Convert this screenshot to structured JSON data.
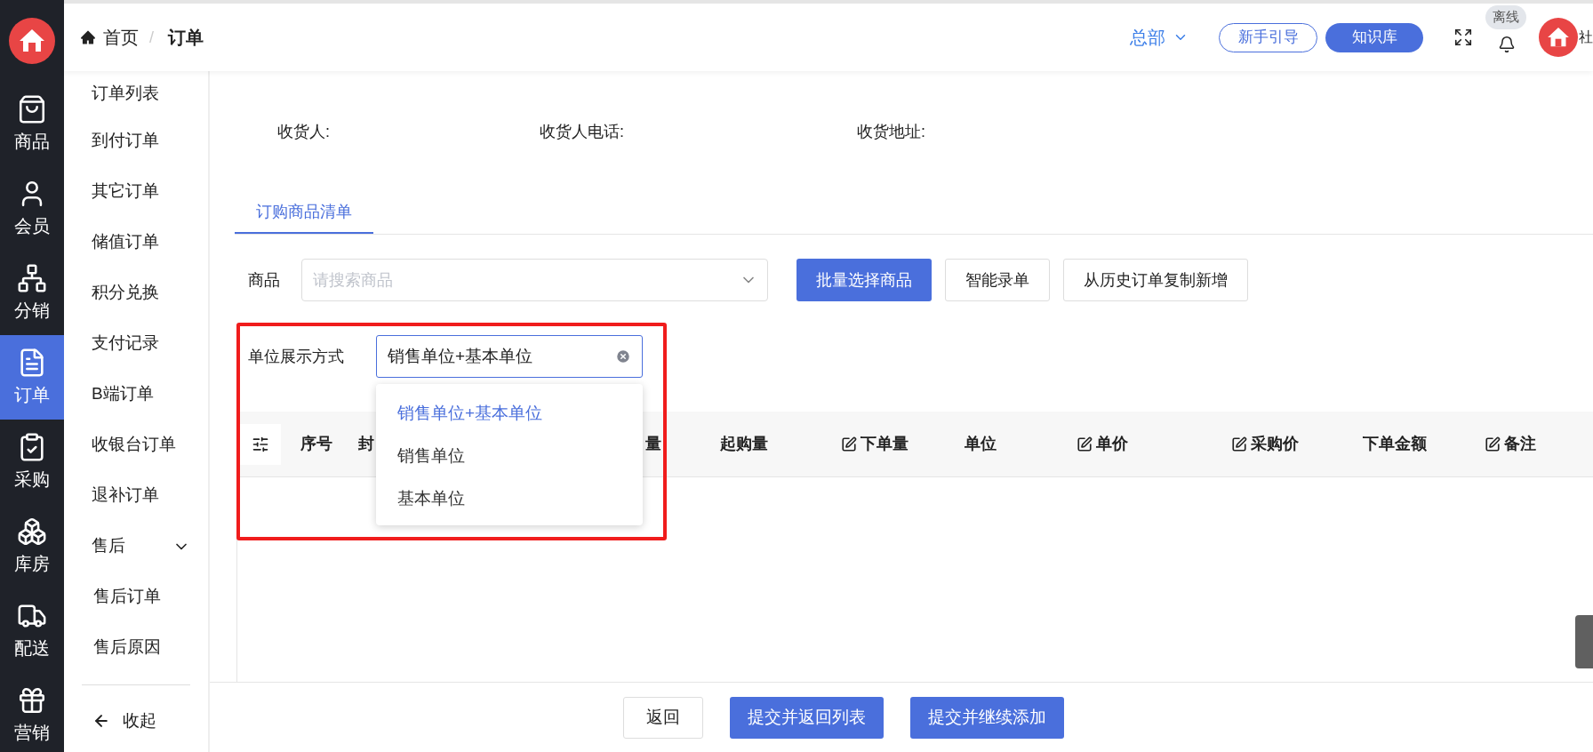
{
  "rail": [
    {
      "label": "商品",
      "selected": false
    },
    {
      "label": "会员",
      "selected": false
    },
    {
      "label": "分销",
      "selected": false
    },
    {
      "label": "订单",
      "selected": true
    },
    {
      "label": "采购",
      "selected": false
    },
    {
      "label": "库房",
      "selected": false
    },
    {
      "label": "配送",
      "selected": false
    },
    {
      "label": "营销",
      "selected": false
    }
  ],
  "breadcrumb": [
    "首页",
    "/",
    "订单"
  ],
  "header": {
    "org": "总部",
    "guide_button": "新手引导",
    "kb_button": "知识库",
    "status_badge": "离线",
    "user": "社"
  },
  "submenu": [
    {
      "label": "订单列表"
    },
    {
      "label": "到付订单"
    },
    {
      "label": "其它订单"
    },
    {
      "label": "储值订单"
    },
    {
      "label": "积分兑换"
    },
    {
      "label": "支付记录"
    },
    {
      "label": "B端订单"
    },
    {
      "label": "收银台订单"
    },
    {
      "label": "退补订单"
    },
    {
      "label": "售后",
      "expanded": true,
      "children": [
        {
          "label": "售后订单"
        },
        {
          "label": "售后原因"
        }
      ]
    }
  ],
  "collapse": "收起",
  "recipient_fields": [
    "收货人:",
    "收货人电话:",
    "收货地址:"
  ],
  "tabs": [
    {
      "label": "订购商品清单",
      "selected": true
    }
  ],
  "product_filter": {
    "label": "商品",
    "placeholder": "请搜索商品"
  },
  "action_buttons": [
    {
      "label": "批量选择商品",
      "primary": true
    },
    {
      "label": "智能录单",
      "primary": false
    },
    {
      "label": "从历史订单复制新增",
      "primary": false
    }
  ],
  "unit_display": {
    "label": "单位展示方式",
    "value": "销售单位+基本单位",
    "options": [
      {
        "label": "销售单位+基本单位",
        "selected": true
      },
      {
        "label": "销售单位",
        "selected": false
      },
      {
        "label": "基本单位",
        "selected": false
      }
    ]
  },
  "table": {
    "columns": [
      {
        "label": "序号",
        "editable": false
      },
      {
        "label": "封",
        "editable": false
      },
      {
        "label": "量",
        "editable": false
      },
      {
        "label": "起购量",
        "editable": false
      },
      {
        "label": "下单量",
        "editable": true
      },
      {
        "label": "单位",
        "editable": false
      },
      {
        "label": "单价",
        "editable": true
      },
      {
        "label": "采购价",
        "editable": true
      },
      {
        "label": "下单金额",
        "editable": false
      },
      {
        "label": "备注",
        "editable": true
      }
    ]
  },
  "footer_buttons": [
    {
      "label": "返回",
      "primary": false
    },
    {
      "label": "提交并返回列表",
      "primary": true
    },
    {
      "label": "提交并继续添加",
      "primary": true
    }
  ]
}
